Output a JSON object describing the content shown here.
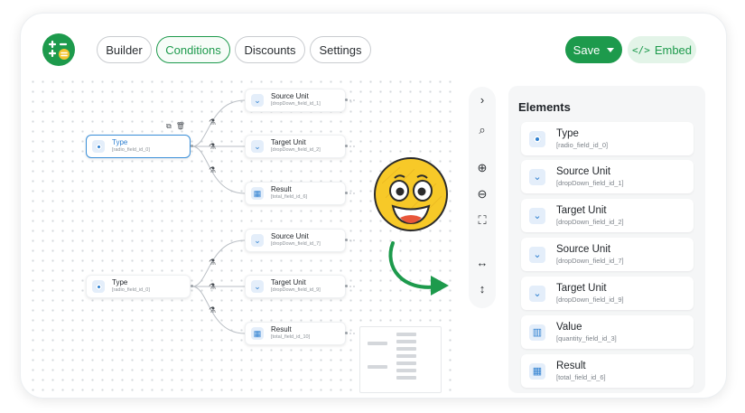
{
  "topbar": {
    "tabs": [
      "Builder",
      "Conditions",
      "Discounts",
      "Settings"
    ],
    "active_tab": "Conditions",
    "save_label": "Save",
    "embed_label": "Embed",
    "embed_icon": "</>"
  },
  "canvas": {
    "nodes": [
      {
        "name": "Type",
        "id": "[radio_field_id_0]",
        "icon": "radio-icon",
        "selected": true
      },
      {
        "name": "Source Unit",
        "id": "[dropDown_field_id_1]",
        "icon": "chevron-down-icon"
      },
      {
        "name": "Target Unit",
        "id": "[dropDown_field_id_2]",
        "icon": "chevron-down-icon"
      },
      {
        "name": "Result",
        "id": "[total_field_id_6]",
        "icon": "calculator-icon"
      },
      {
        "name": "Type",
        "id": "[radio_field_id_0]",
        "icon": "radio-icon"
      },
      {
        "name": "Source Unit",
        "id": "[dropDown_field_id_7]",
        "icon": "chevron-down-icon"
      },
      {
        "name": "Target Unit",
        "id": "[dropDown_field_id_9]",
        "icon": "chevron-down-icon"
      },
      {
        "name": "Result",
        "id": "[total_field_id_10]",
        "icon": "calculator-icon"
      }
    ]
  },
  "panel": {
    "title": "Elements",
    "items": [
      {
        "name": "Type",
        "id": "[radio_field_id_0]",
        "icon": "radio-icon"
      },
      {
        "name": "Source Unit",
        "id": "[dropDown_field_id_1]",
        "icon": "chevron-down-icon"
      },
      {
        "name": "Target Unit",
        "id": "[dropDown_field_id_2]",
        "icon": "chevron-down-icon"
      },
      {
        "name": "Source Unit",
        "id": "[dropDown_field_id_7]",
        "icon": "chevron-down-icon"
      },
      {
        "name": "Target Unit",
        "id": "[dropDown_field_id_9]",
        "icon": "chevron-down-icon"
      },
      {
        "name": "Value",
        "id": "[quantity_field_id_3]",
        "icon": "quantity-icon"
      },
      {
        "name": "Result",
        "id": "[total_field_id_6]",
        "icon": "calculator-icon"
      }
    ]
  },
  "colors": {
    "accent": "#1d9a4c",
    "field_icon": "#2d7fd0",
    "selection": "#3a8fd9"
  }
}
